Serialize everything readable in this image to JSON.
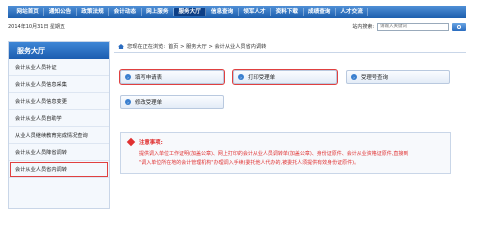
{
  "nav": {
    "items": [
      "网站首页",
      "通知公告",
      "政策法规",
      "会计动态",
      "网上服务",
      "服务大厅",
      "信息查询",
      "领军人才",
      "资料下载",
      "成绩查询",
      "人才交流"
    ],
    "active_index": 5
  },
  "infobar": {
    "date": "2014年10月31日  星期五",
    "search_label": "站内搜索:",
    "search_placeholder": "请输入关键词"
  },
  "sidebar": {
    "title": "服务大厅",
    "items": [
      "会计从业人员补证",
      "会计从业人员信息采集",
      "会计从业人员信息变更",
      "会计从业人员自助学",
      "从业人员继续教育完成情况查询",
      "会计从业人员降省调转",
      "会计从业人员省内调转"
    ],
    "selected_index": 6
  },
  "breadcrumb": {
    "prefix": "您现在正在浏览:",
    "path": "首页 > 服务大厅 > 会计从业人员省内调转"
  },
  "actions": {
    "fill_form": "填写申请表",
    "print_form": "打印受理单",
    "check_status": "受理号查询",
    "modify_form": "修改受理单"
  },
  "notice": {
    "title": "注意事项:",
    "line1": "提供调入单位工作证明(加盖公章)、网上打印的会计从业人员调转单(加盖公章)、身份证原件、会计从业资格证原件,直接到",
    "line2": "\"调入单位所在地的会计管理机构\"办理调入手续(委托他人代办的,被委托人须提供有效身份证原件)。"
  },
  "colors": {
    "nav_blue": "#1d5fae",
    "highlight_red": "#e04040",
    "notice_red": "#e03030"
  }
}
